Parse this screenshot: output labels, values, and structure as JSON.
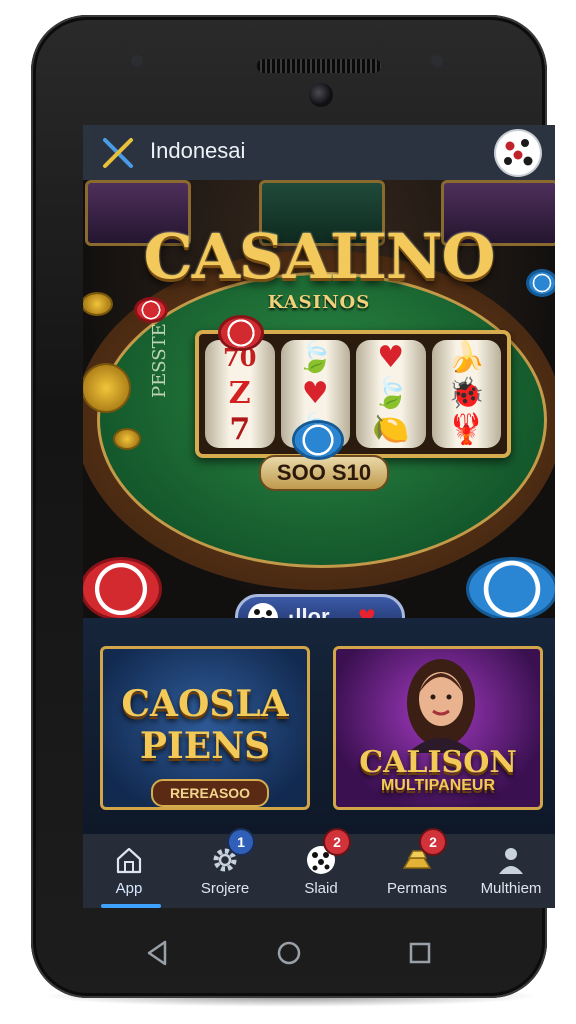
{
  "header": {
    "title": "Indonesai",
    "close_icon": "close-x-icon",
    "avatar_icon": "dice-avatar-icon"
  },
  "hero": {
    "brand_title": "CASAIINO",
    "brand_subtitle": "KASINOS",
    "felt_text": "PESSTE",
    "reel_symbols": [
      [
        "70",
        "Z",
        "7"
      ],
      [
        "🍃",
        "♥",
        "🍃"
      ],
      [
        "♥",
        "🍃",
        "🍋"
      ],
      [
        "🍌",
        "🐞",
        "🦞"
      ]
    ],
    "bet_display": "SOO S10",
    "play_button_label": "·llor"
  },
  "promos": {
    "left": {
      "title_line1": "CAOSLA",
      "title_line2": "PIENS",
      "badge": "REREASOO"
    },
    "right": {
      "title": "CALISON",
      "subtitle": "MULTIPANEUR"
    }
  },
  "bottom_nav": {
    "items": [
      {
        "label": "App",
        "icon": "house-icon",
        "active": true,
        "badge": ""
      },
      {
        "label": "Srojere",
        "icon": "gear-icon",
        "active": false,
        "badge": "1"
      },
      {
        "label": "Slaid",
        "icon": "dice-icon",
        "active": false,
        "badge": "2"
      },
      {
        "label": "Permans",
        "icon": "gold-bars-icon",
        "active": false,
        "badge": "2"
      },
      {
        "label": "Multhiem",
        "icon": "person-icon",
        "active": false,
        "badge": ""
      }
    ]
  },
  "system_nav": {
    "back": "back-triangle-icon",
    "home": "home-circle-icon",
    "recents": "recents-square-icon"
  },
  "colors": {
    "accent_blue": "#3fa2ff",
    "gold": "#f2c95a",
    "badge_red": "#d2333a",
    "badge_blue": "#2f5fb8",
    "felt_green": "#2c8a45"
  }
}
